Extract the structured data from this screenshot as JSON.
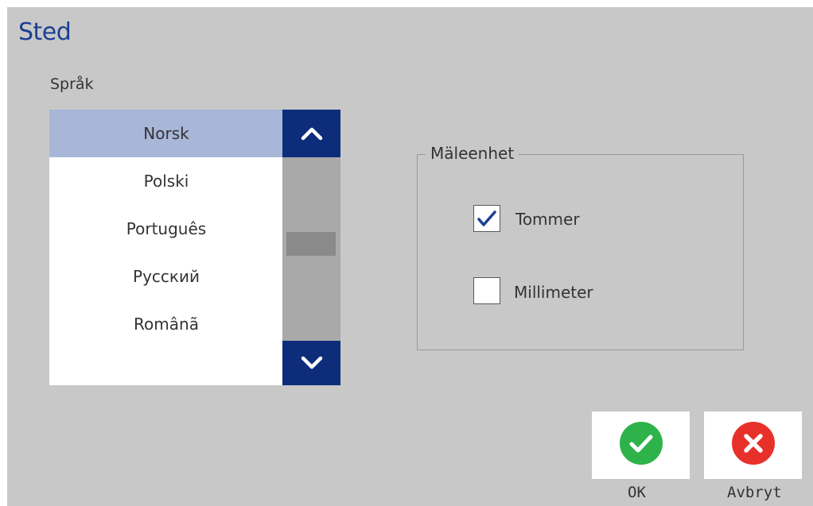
{
  "dialog": {
    "title": "Sted",
    "language_label": "Språk",
    "languages": [
      "Norsk",
      "Polski",
      "Português",
      "Русский",
      "Românã"
    ],
    "selected_language": "Norsk",
    "scroll_position": 0.5,
    "units_group": {
      "legend": "Mäleenhet",
      "options": [
        {
          "label": "Tommer",
          "checked": true
        },
        {
          "label": "Millimeter",
          "checked": false
        }
      ]
    },
    "buttons": {
      "ok_label": "OK",
      "cancel_label": "Avbryt"
    }
  },
  "colors": {
    "title": "#1c3f94",
    "selected_row": "#a8b6d8",
    "scroll_button": "#0d2c7a",
    "ok_green": "#2db34a",
    "cancel_red": "#e8302a"
  },
  "icons": {
    "scroll_up": "chevron-up-icon",
    "scroll_down": "chevron-down-icon",
    "ok": "checkmark-circle-icon",
    "cancel": "x-circle-icon"
  }
}
